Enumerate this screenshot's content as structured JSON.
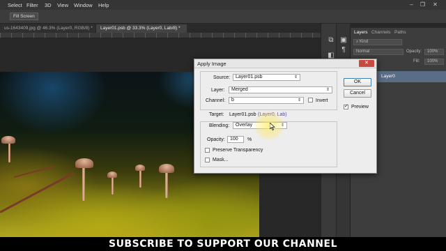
{
  "menubar": {
    "items": [
      "Select",
      "Filter",
      "3D",
      "View",
      "Window",
      "Help"
    ]
  },
  "options_bar": {
    "fill_screen_label": "Fill Screen"
  },
  "tabs": [
    {
      "label": "us-1643409.jpg @ 46.3% (Layer0, RGB/8) *"
    },
    {
      "label": "Layer01.psb @ 33.3% (Layer0, Lab/8) *"
    }
  ],
  "layers_panel": {
    "tabs": [
      "Layers",
      "Channels",
      "Paths"
    ],
    "filter_label": "Kind",
    "blend_mode": "Normal",
    "opacity_label": "Opacity:",
    "opacity_value": "100%",
    "fill_label": "Fill:",
    "fill_value": "100%",
    "layer_name": "Layer0"
  },
  "dialog": {
    "title": "Apply Image",
    "source_label": "Source:",
    "source_value": "Layer01.psb",
    "layer_label": "Layer:",
    "layer_value": "Merged",
    "channel_label": "Channel:",
    "channel_value": "b",
    "invert_label": "Invert",
    "invert_checked": false,
    "target_label": "Target:",
    "target_file": "Layer01.psb",
    "target_detail": "(Layer0, Lab)",
    "blending_label": "Blending:",
    "blending_value": "Overlay",
    "opacity_label": "Opacity:",
    "opacity_value": "100",
    "opacity_unit": "%",
    "preserve_label": "Preserve Transparency",
    "preserve_checked": false,
    "mask_label": "Mask...",
    "mask_checked": false,
    "ok_label": "OK",
    "cancel_label": "Cancel",
    "preview_label": "Preview",
    "preview_checked": true
  },
  "banner": {
    "text": "SUBSCRIBE TO SUPPORT OUR CHANNEL"
  }
}
